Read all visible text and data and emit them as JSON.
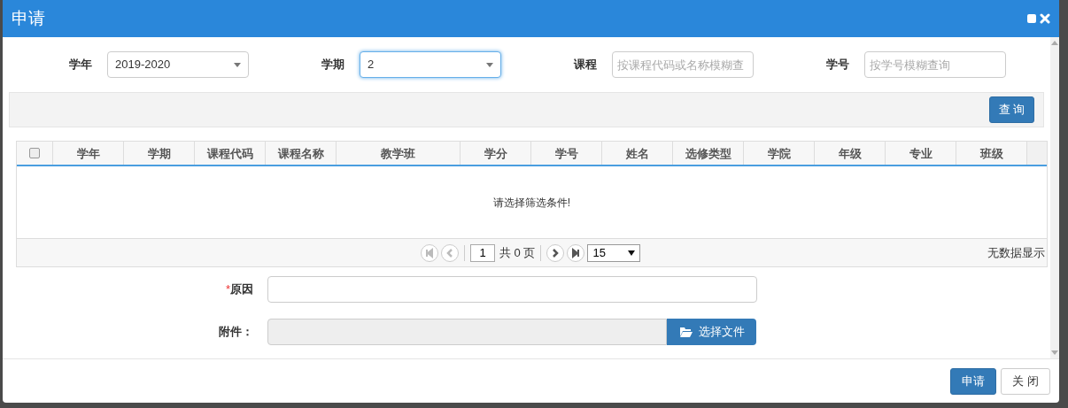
{
  "window": {
    "title": "申请"
  },
  "filters": [
    {
      "kind": "select",
      "label": "学年",
      "value": "2019-2020",
      "focused": false
    },
    {
      "kind": "select",
      "label": "学期",
      "value": "2",
      "focused": true
    },
    {
      "kind": "input",
      "label": "课程",
      "placeholder": "按课程代码或名称模糊查"
    },
    {
      "kind": "input",
      "label": "学号",
      "placeholder": "按学号模糊查询"
    }
  ],
  "search_button": "查 询",
  "table": {
    "select_all": {
      "checked": false
    },
    "columns": [
      "学年",
      "学期",
      "课程代码",
      "课程名称",
      "教学班",
      "学分",
      "学号",
      "姓名",
      "选修类型",
      "学院",
      "年级",
      "专业",
      "班级"
    ],
    "empty_message": "请选择筛选条件!"
  },
  "pager": {
    "nav": [
      {
        "kind": "first",
        "disabled": true
      },
      {
        "kind": "prev",
        "disabled": true
      }
    ],
    "page": "1",
    "total": "共 0 页",
    "nav_after": [
      {
        "kind": "next",
        "disabled": false
      },
      {
        "kind": "last",
        "disabled": false
      }
    ],
    "page_size": "15",
    "summary": "无数据显示"
  },
  "form": {
    "reason": {
      "label": "原因",
      "required_mark": "*"
    },
    "attachment": {
      "label": "附件：",
      "button": "选择文件"
    }
  },
  "footer_buttons": [
    {
      "label": "申请",
      "kind": "primary"
    },
    {
      "label": "关 闭",
      "kind": "default"
    }
  ]
}
